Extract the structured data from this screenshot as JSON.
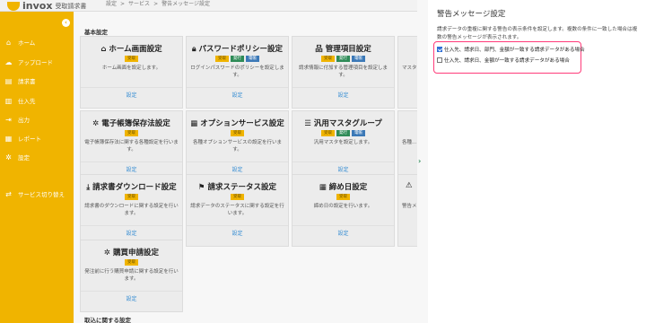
{
  "header": {
    "logo": "invox",
    "logo_sub": "受取請求書",
    "breadcrumbs": [
      "設定",
      ">",
      "サービス",
      ">",
      "警告メッセージ設定"
    ]
  },
  "sidebar": {
    "collapse_icon": "chevron-left-icon",
    "items": [
      {
        "label": "ホーム",
        "icon": "home-icon"
      },
      {
        "label": "アップロード",
        "icon": "upload-icon"
      },
      {
        "label": "請求書",
        "icon": "document-icon"
      },
      {
        "label": "仕入先",
        "icon": "building-icon"
      },
      {
        "label": "出力",
        "icon": "output-icon"
      },
      {
        "label": "レポート",
        "icon": "report-icon"
      },
      {
        "label": "設定",
        "icon": "gear-icon"
      },
      {
        "label": "サービス切り替え",
        "icon": "switch-icon"
      }
    ]
  },
  "main": {
    "section_basic": "基本設定",
    "section_bottom": "取込に関する設定",
    "cards": [
      {
        "title": "ホーム画面設定",
        "badges": [
          "受取"
        ],
        "desc": "ホーム画面を設定します。",
        "link": "設定"
      },
      {
        "title": "パスワードポリシー設定",
        "badges": [
          "受取",
          "発行",
          "電帳"
        ],
        "desc": "ログインパスワードのポリシーを設定します。",
        "link": "設定"
      },
      {
        "title": "管理項目設定",
        "badges": [
          "受取",
          "発行",
          "電帳"
        ],
        "desc": "請求情報に付加する管理項目を設定します。",
        "link": "設定"
      },
      {
        "title": "電子帳簿保存法設定",
        "badges": [
          "受取"
        ],
        "desc": "電子帳簿保存法に関する各種設定を行います。",
        "link": "設定"
      },
      {
        "title": "オプションサービス設定",
        "badges": [
          "受取"
        ],
        "desc": "各種オプションサービスの設定を行います。",
        "link": "設定"
      },
      {
        "title": "汎用マスタグループ",
        "badges": [
          "受取",
          "発行",
          "電帳"
        ],
        "desc": "汎用マスタを設定します。",
        "link": "設定"
      },
      {
        "title": "請求書ダウンロード設定",
        "badges": [
          "受取"
        ],
        "desc": "請求書のダウンロードに関する設定を行います。",
        "link": "設定"
      },
      {
        "title": "請求ステータス設定",
        "badges": [
          "受取"
        ],
        "desc": "請求データのステータスに関する設定を行います。",
        "link": "設定"
      },
      {
        "title": "締め日設定",
        "badges": [
          "受取"
        ],
        "desc": "締め日の設定を行います。",
        "link": "設定"
      },
      {
        "title": "購買申請設定",
        "badges": [
          "受取"
        ],
        "desc": "発注前に行う購買申請に関する設定を行います。",
        "link": "設定"
      }
    ],
    "partial_cards": [
      {
        "desc": "マスタ..."
      },
      {
        "desc": "各種..."
      },
      {
        "desc": "警告メ..."
      }
    ]
  },
  "panel": {
    "title": "警告メッセージ設定",
    "desc": "請求データの重複に関する警告の表示条件を設定します。複数の条件に一致した場合は複数の警告メッセージが表示されます。",
    "options": [
      {
        "label": "仕入先、請求日、部門、金額が一致する請求データがある場合",
        "checked": true
      },
      {
        "label": "仕入先、請求日、金額が一致する請求データがある場合",
        "checked": false
      }
    ],
    "expand_icon": "chevron-right-icon"
  },
  "colors": {
    "brand": "#f0b400",
    "link": "#3a8fd3",
    "highlight": "#ff3b7a"
  }
}
